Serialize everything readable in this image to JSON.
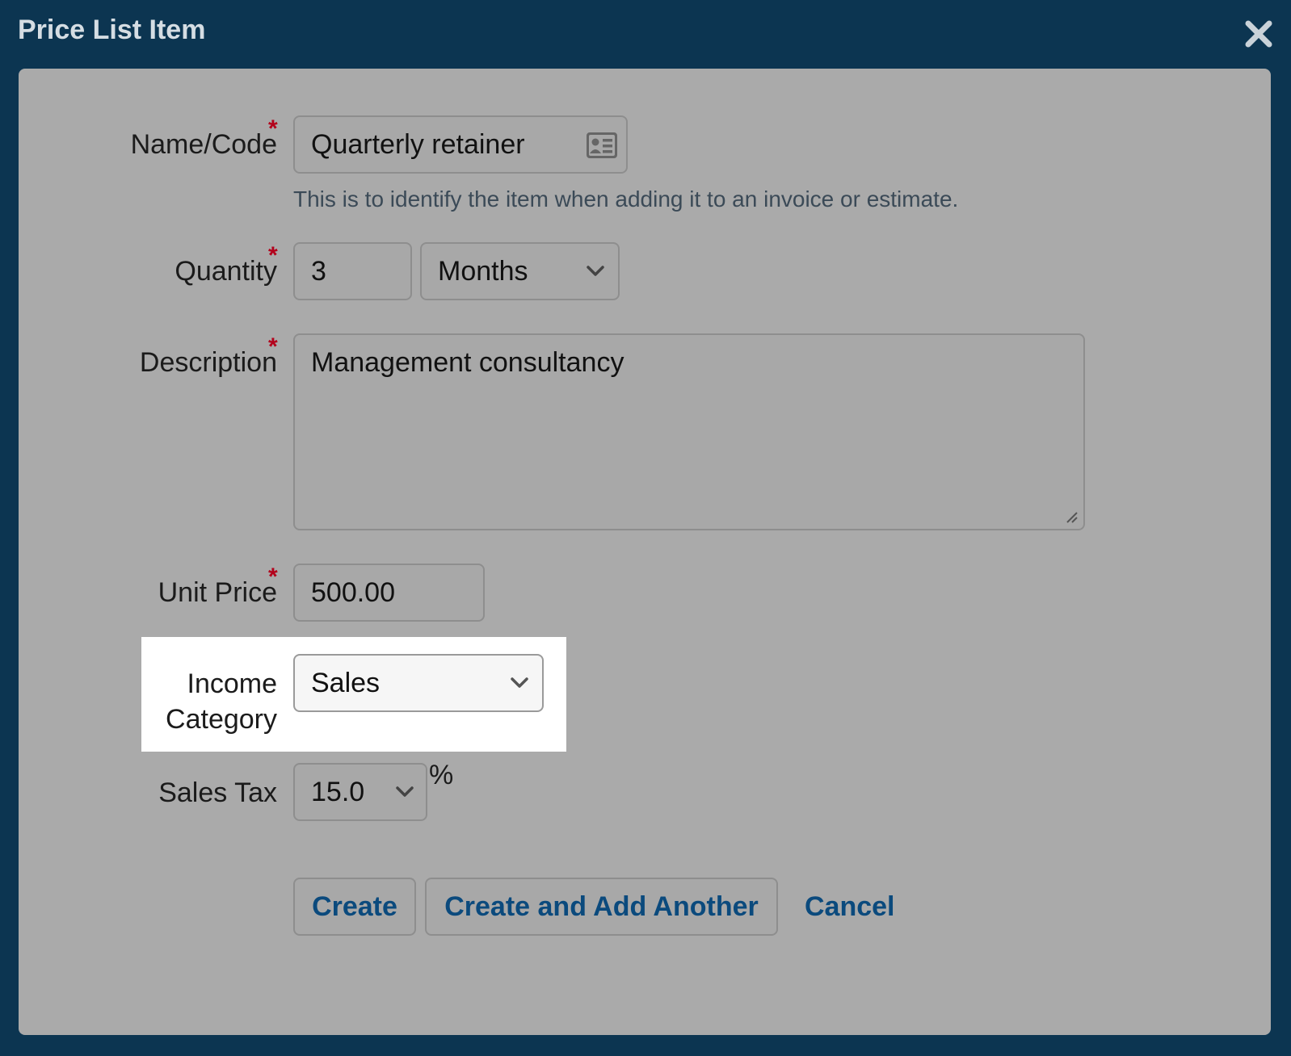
{
  "dialog": {
    "title": "Price List Item",
    "close_icon": "close-icon"
  },
  "colors": {
    "backdrop": "#0c3551",
    "panel": "#aaaaaa",
    "required": "#b3001b",
    "link": "#0b4a7d",
    "highlight": "#ffffff"
  },
  "form": {
    "name": {
      "label": "Name/Code",
      "required_mark": "*",
      "value": "Quarterly retainer",
      "icon": "contact-card-icon",
      "help": "This is to identify the item when adding it to an invoice or estimate."
    },
    "quantity": {
      "label": "Quantity",
      "required_mark": "*",
      "value": "3",
      "unit_selected": "Months"
    },
    "description": {
      "label": "Description",
      "required_mark": "*",
      "value": "Management consultancy"
    },
    "unit_price": {
      "label": "Unit Price",
      "required_mark": "*",
      "value": "500.00"
    },
    "income_category": {
      "label_line1": "Income",
      "label_line2": "Category",
      "selected": "Sales"
    },
    "sales_tax": {
      "label": "Sales Tax",
      "selected": "15.0",
      "suffix": "%"
    }
  },
  "actions": {
    "create": "Create",
    "create_another": "Create and Add Another",
    "cancel": "Cancel"
  }
}
